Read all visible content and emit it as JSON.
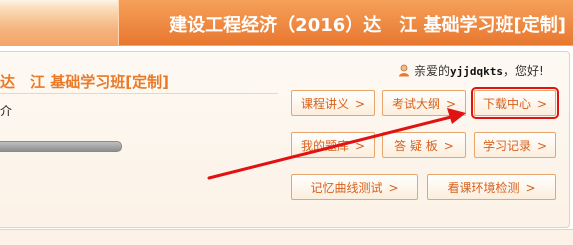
{
  "banner": {
    "title": "建设工程经济（2016）达　江 基础学习班[定制]"
  },
  "course": {
    "title": "达　江 基础学习班[定制]",
    "intro_label": "介"
  },
  "user": {
    "greeting_prefix": "亲爱的",
    "username": "yjjdqkts",
    "greeting_suffix": "，您好!"
  },
  "buttons": {
    "lecture": "课程讲义",
    "syllabus": "考试大纲",
    "download": "下载中心",
    "my_questions": "我的题库",
    "qa_board": "答 疑 板",
    "study_record": "学习记录",
    "memory_test": "记忆曲线测试",
    "env_check": "看课环境检测",
    "chevron": ">"
  },
  "colors": {
    "accent": "#e8772f",
    "button_text": "#d8601c",
    "annotation": "#e11212"
  }
}
